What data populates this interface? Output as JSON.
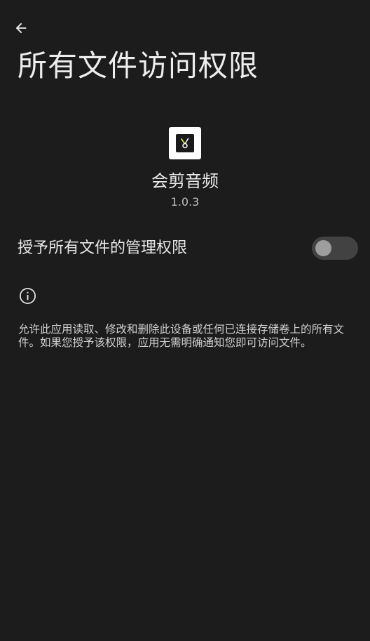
{
  "header": {
    "back_icon": "arrow-left-icon",
    "title": "所有文件访问权限"
  },
  "app": {
    "icon": "app-logo-icon",
    "name": "会剪音频",
    "version": "1.0.3"
  },
  "permission": {
    "label": "授予所有文件的管理权限",
    "enabled": false
  },
  "info": {
    "icon": "info-icon",
    "description": "允许此应用读取、修改和删除此设备或任何已连接存储卷上的所有文件。如果您授予该权限，应用无需明确通知您即可访问文件。"
  },
  "colors": {
    "background": "#1c1c1c",
    "text": "#e8e8e8",
    "toggle_track": "#424242",
    "toggle_thumb": "#9e9e9e"
  }
}
